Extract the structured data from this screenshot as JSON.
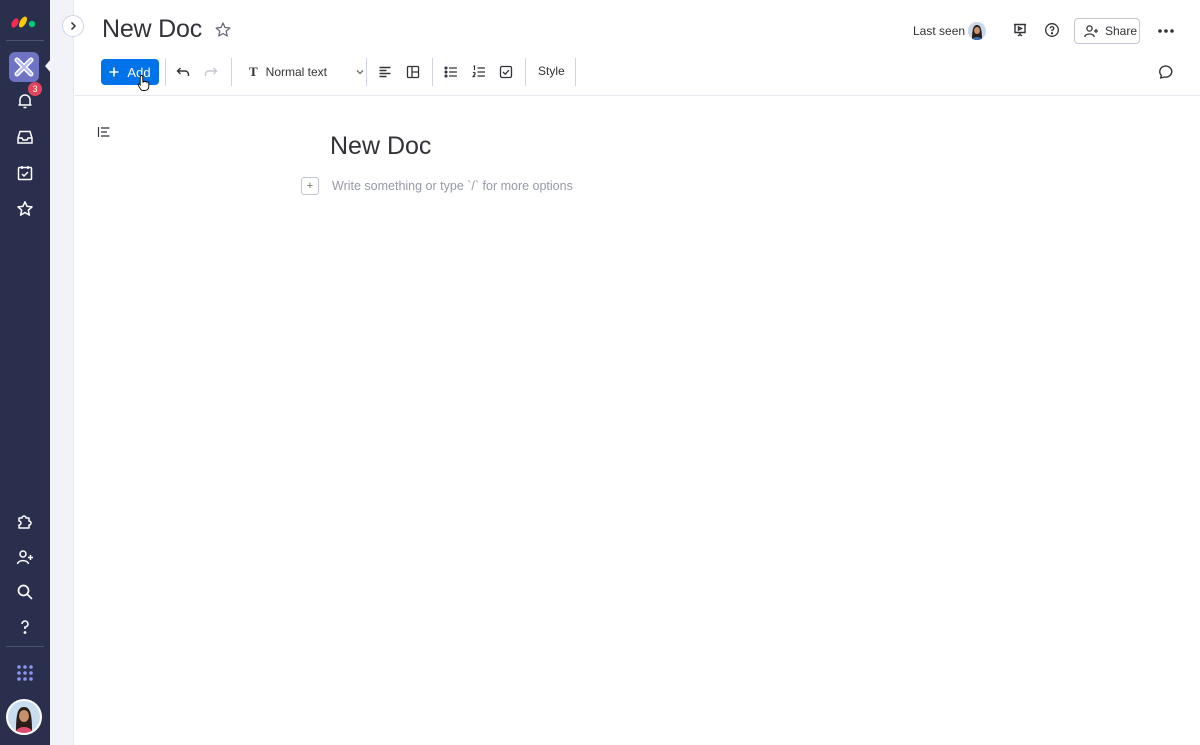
{
  "rail": {
    "notification_count": "3",
    "items": [
      {
        "name": "notifications-icon"
      },
      {
        "name": "inbox-icon"
      },
      {
        "name": "my-work-icon"
      },
      {
        "name": "favorites-icon"
      },
      {
        "name": "apps-icon"
      },
      {
        "name": "invite-icon"
      },
      {
        "name": "search-icon"
      },
      {
        "name": "help-icon"
      },
      {
        "name": "product-switcher-icon"
      }
    ]
  },
  "header": {
    "title": "New Doc",
    "last_seen_label": "Last seen",
    "share_label": "Share"
  },
  "toolbar": {
    "add_label": "Add",
    "text_style": "Normal text",
    "text_style_glyph": "T",
    "style_label": "Style"
  },
  "document": {
    "heading": "New Doc",
    "block_placeholder": "Write something or type `/` for more options",
    "block_plus": "+"
  },
  "colors": {
    "rail_bg": "#292f4c",
    "accent": "#0073ea",
    "badge": "#e2445c"
  }
}
